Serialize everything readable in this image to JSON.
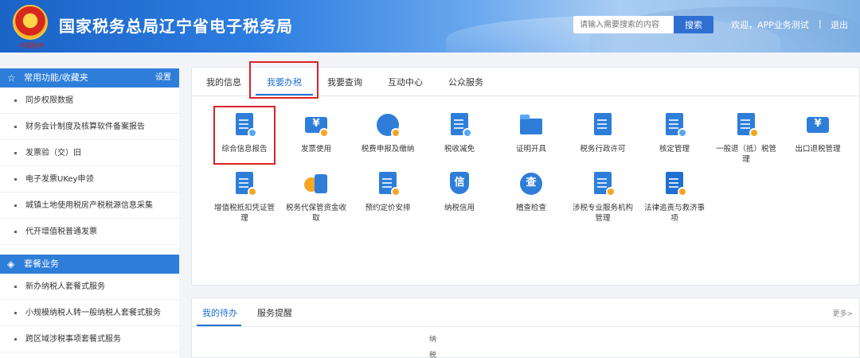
{
  "header": {
    "site_title": "国家税务总局辽宁省电子税务局",
    "emblem_text": "中国税务",
    "search_placeholder": "请输入需要搜索的内容",
    "search_button": "搜索",
    "welcome": "欢迎，APP业务测试",
    "separator": "|",
    "logout": "退出"
  },
  "sidebar": {
    "favorites_title": "常用功能/收藏夹",
    "settings": "设置",
    "favorites": [
      "同步权限数据",
      "财务会计制度及核算软件备案报告",
      "发票验（交）旧",
      "电子发票UKey申领",
      "城镇土地使用税房产税税源信息采集",
      "代开增值税普通发票"
    ],
    "package_title": "套餐业务",
    "packages": [
      "新办纳税人套餐式服务",
      "小规模纳税人转一般纳税人套餐式服务",
      "跨区域涉税事项套餐式服务"
    ]
  },
  "tabs": [
    "我的信息",
    "我要办税",
    "我要查询",
    "互动中心",
    "公众服务"
  ],
  "active_tab": "我要办税",
  "services": [
    {
      "label": "综合信息报告",
      "icon": "report-document-icon"
    },
    {
      "label": "发票使用",
      "icon": "invoice-icon"
    },
    {
      "label": "税费申报及缴纳",
      "icon": "tax-declaration-icon"
    },
    {
      "label": "税收减免",
      "icon": "tax-reduction-icon"
    },
    {
      "label": "证明开具",
      "icon": "certificate-folder-icon"
    },
    {
      "label": "税务行政许可",
      "icon": "administrative-license-icon"
    },
    {
      "label": "核定管理",
      "icon": "assessment-management-icon"
    },
    {
      "label": "一般退（抵）税管理",
      "icon": "tax-refund-icon"
    },
    {
      "label": "出口退税管理",
      "icon": "export-refund-icon"
    },
    {
      "label": "增值税抵扣凭证管理",
      "icon": "vat-deduction-icon"
    },
    {
      "label": "税务代保管资金收取",
      "icon": "custody-funds-icon"
    },
    {
      "label": "预约定价安排",
      "icon": "pricing-arrangement-icon"
    },
    {
      "label": "纳税信用",
      "icon": "tax-credit-icon"
    },
    {
      "label": "稽查检查",
      "icon": "inspection-shield-icon"
    },
    {
      "label": "涉税专业服务机构管理",
      "icon": "service-agency-icon"
    },
    {
      "label": "法律追责与救济事项",
      "icon": "legal-remedy-icon"
    }
  ],
  "icon_glyphs": {
    "invoice": "¥",
    "credit": "信",
    "inspection": "查",
    "export": "¥"
  },
  "todo": {
    "tabs": [
      "我的待办",
      "服务提醒"
    ],
    "more": "更多>",
    "column_text": "纳税"
  },
  "colors": {
    "primary": "#2e7ed9",
    "highlight": "#d9222a",
    "accent": "#f5a623"
  }
}
